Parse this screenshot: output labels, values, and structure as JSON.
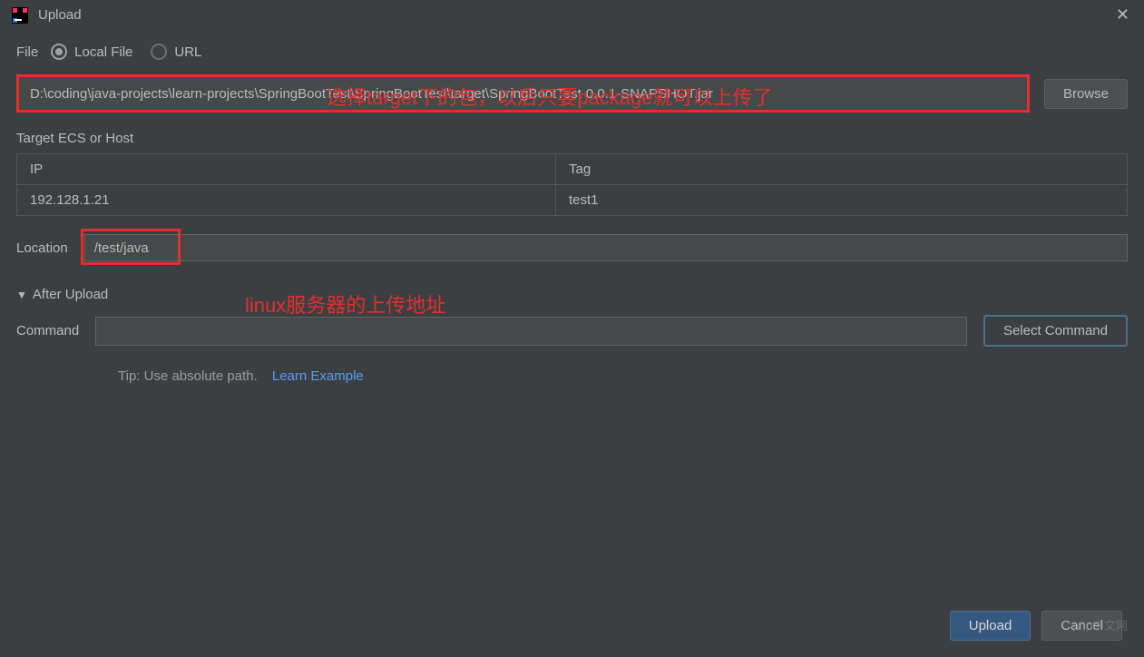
{
  "title": "Upload",
  "file": {
    "label": "File",
    "local_file_label": "Local File",
    "url_label": "URL",
    "path_value": "D:\\coding\\java-projects\\learn-projects\\SpringBootTest\\SpringBootTest\\target\\SpringBootTest-0.0.1-SNAPSHOT.jar",
    "browse_label": "Browse"
  },
  "target": {
    "label": "Target ECS or Host",
    "headers": {
      "ip": "IP",
      "tag": "Tag"
    },
    "rows": [
      {
        "ip": "192.128.1.21",
        "tag": "test1"
      }
    ]
  },
  "location": {
    "label": "Location",
    "value": "/test/java"
  },
  "after_upload": {
    "label": "After Upload",
    "command_label": "Command",
    "command_value": "",
    "select_command_label": "Select Command",
    "tip": "Tip: Use absolute path.",
    "learn_link": "Learn Example"
  },
  "footer": {
    "upload_label": "Upload",
    "cancel_label": "Cancel"
  },
  "annotations": {
    "top": "选择target下的包，以后只要package就可以上传了",
    "location": "linux服务器的上传地址"
  },
  "watermark": "php中文网"
}
